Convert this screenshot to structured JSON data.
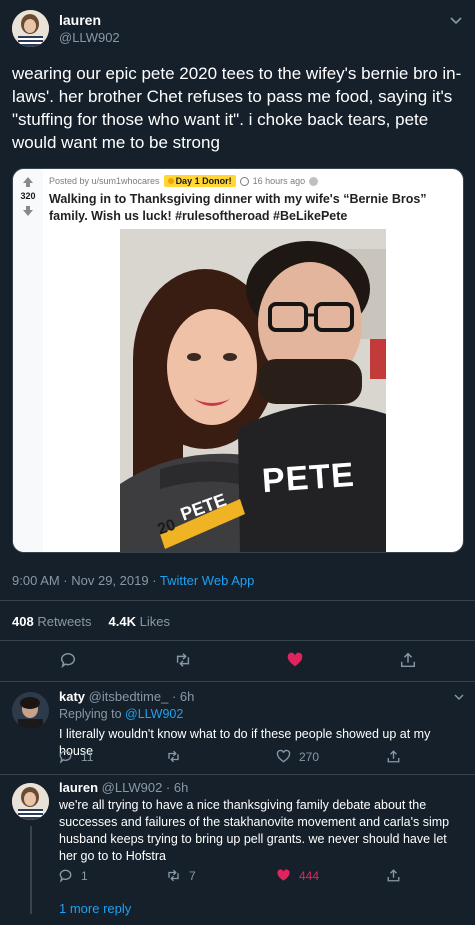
{
  "tweet": {
    "author_name": "lauren",
    "author_handle": "@LLW902",
    "text": "wearing our epic pete 2020 tees to the wifey's bernie bro in-laws'. her brother Chet refuses to pass me food, saying it's \"stuffing for those who want it\". i choke back tears, pete would want me to be strong",
    "timestamp": "9:00 AM · Nov 29, 2019 · ",
    "source": "Twitter Web App",
    "retweets_count": "408",
    "retweets_label": "Retweets",
    "likes_count": "4.4K",
    "likes_label": "Likes"
  },
  "embedded_post": {
    "score": "320",
    "posted_by": "Posted by u/sum1whocares",
    "award": "Day 1 Donor!",
    "time": "16 hours ago",
    "title": "Walking in to Thanksgiving dinner with my wife's “Bernie Bros” family. Wish us luck! #rulesoftheroad #BeLikePete",
    "shirt_text": "PETE",
    "shirt_text_2": "PETE",
    "shirt_number": "20"
  },
  "replies": [
    {
      "name": "katy",
      "handle": "@itsbedtime_",
      "time": "· 6h",
      "replying_prefix": "Replying to ",
      "replying_to": "@LLW902",
      "text": "I literally wouldn't know what to do if these people showed up at my house",
      "reply_count": "11",
      "retweet_count": "",
      "like_count": "270"
    },
    {
      "name": "lauren",
      "handle": "@LLW902",
      "time": "· 6h",
      "text": "we're all trying to have a nice thanksgiving family debate about the successes and failures of the stakhanovite movement and carla's simp husband keeps trying to bring up pell grants. we never should have let her go to to Hofstra",
      "reply_count": "1",
      "retweet_count": "7",
      "like_count": "444"
    }
  ],
  "more_replies": "1 more reply",
  "colors": {
    "background": "#15202b",
    "accent": "#1da1f2",
    "like": "#e0245e",
    "muted": "#8899a6"
  }
}
